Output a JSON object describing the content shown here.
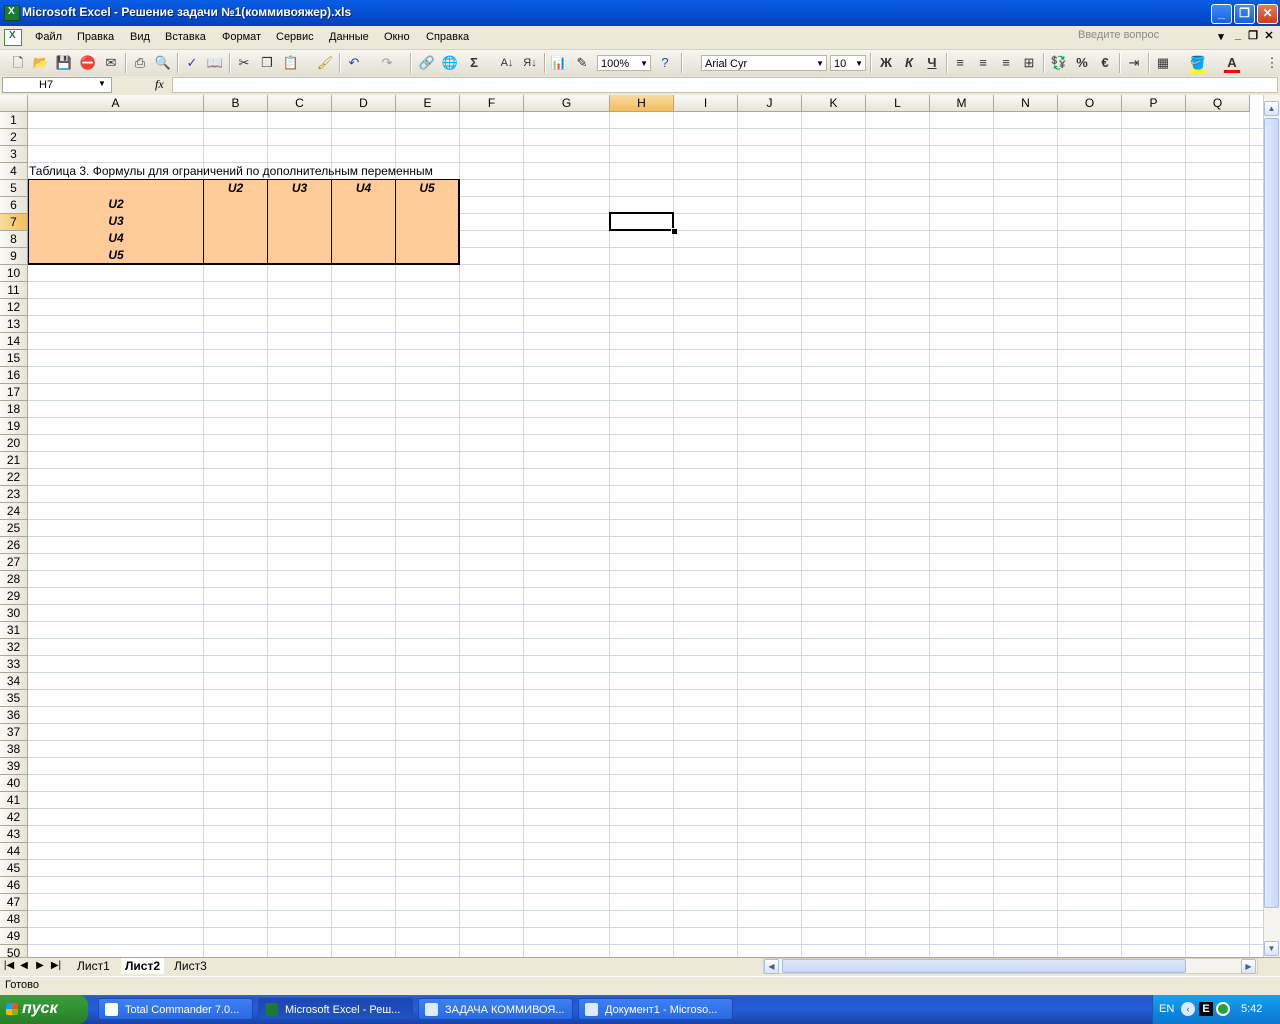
{
  "window": {
    "title": "Microsoft Excel - Решение задачи №1(коммивояжер).xls",
    "controls": {
      "minimize": "_",
      "restore": "❐",
      "close": "✕"
    }
  },
  "menu": {
    "items": [
      "Файл",
      "Правка",
      "Вид",
      "Вставка",
      "Формат",
      "Сервис",
      "Данные",
      "Окно",
      "Справка"
    ],
    "help_placeholder": "Введите вопрос"
  },
  "toolbar": {
    "zoom": "100%",
    "font_name": "Arial Cyr",
    "font_size": "10",
    "bold_label": "Ж",
    "italic_label": "К",
    "underline_label": "Ч",
    "sum_label": "Σ",
    "percent_label": "%",
    "euro_label": "€",
    "icons": [
      "new-icon",
      "open-icon",
      "save-icon",
      "permission-icon",
      "print-icon",
      "preview-icon",
      "spelling-icon",
      "research-icon",
      "cut-icon",
      "copy-icon",
      "paste-icon",
      "format-painter-icon",
      "undo-icon",
      "redo-icon",
      "hyperlink-icon",
      "sum-icon",
      "sort-asc-icon",
      "sort-desc-icon",
      "chart-icon",
      "drawing-icon",
      "help-icon",
      "align-left-icon",
      "align-center-icon",
      "align-right-icon",
      "merge-icon",
      "currency-icon",
      "indent-icon",
      "borders-icon",
      "fill-color-icon",
      "font-color-icon"
    ],
    "colors": {
      "fill": "#ffff00",
      "font": "#ff0000"
    }
  },
  "formula_bar": {
    "name_box": "H7",
    "fx_label": "fx",
    "formula": ""
  },
  "sheet": {
    "columns": [
      "A",
      "B",
      "C",
      "D",
      "E",
      "F",
      "G",
      "H",
      "I",
      "J",
      "K",
      "L",
      "M",
      "N",
      "O",
      "P",
      "Q"
    ],
    "selected_column": "H",
    "selected_row": 7,
    "selected_cell": "H7",
    "rows_visible": 50,
    "table_caption": "Таблица 3. Формулы для ограничений по дополнительным переменным",
    "table_header": [
      "",
      "U2",
      "U3",
      "U4",
      "U5"
    ],
    "table_rows": [
      "U2",
      "U3",
      "U4",
      "U5"
    ],
    "table_fill_color": "#ffcc99"
  },
  "tabs": {
    "sheets": [
      "Лист1",
      "Лист2",
      "Лист3"
    ],
    "active": "Лист2"
  },
  "status": {
    "text": "Готово"
  },
  "taskbar": {
    "start_label": "пуск",
    "items": [
      "Total Commander 7.0...",
      "Microsoft Excel - Реш...",
      "ЗАДАЧА КОММИВОЯ...",
      "Документ1 - Microso..."
    ],
    "active_index": 1,
    "tray": {
      "lang": "EN",
      "clock": "5:42"
    }
  }
}
